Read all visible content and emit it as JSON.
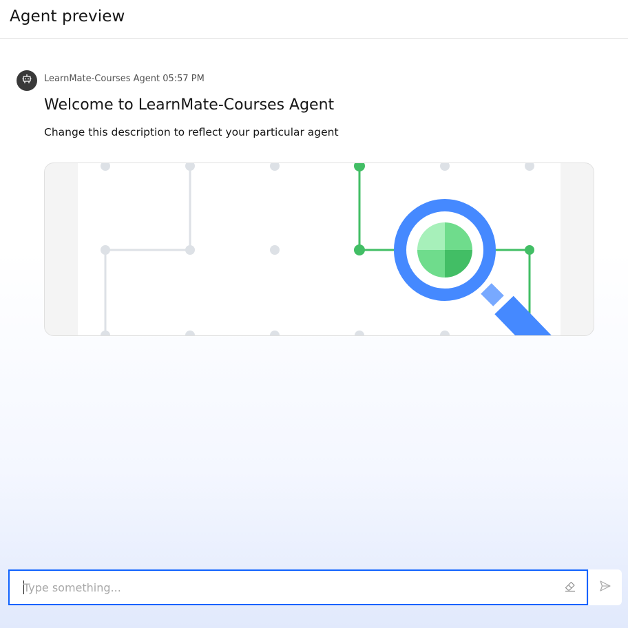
{
  "header": {
    "title": "Agent preview"
  },
  "message": {
    "agent_name": "LearnMate-Courses Agent",
    "time": "05:57 PM",
    "meta": "LearnMate-Courses Agent 05:57 PM",
    "avatar_icon": "robot-icon",
    "title": "Welcome to LearnMate-Courses Agent",
    "description": "Change this description to reflect your particular agent",
    "illustration_icon": "magnifying-glass-icon"
  },
  "composer": {
    "placeholder": "Type something...",
    "value": "",
    "clear_icon": "eraser-icon",
    "send_icon": "send-icon"
  },
  "colors": {
    "accent": "#0f62fe",
    "magnifier_blue": "#4589ff",
    "node_green": "#42be65",
    "grid_gray": "#dde1e6"
  }
}
